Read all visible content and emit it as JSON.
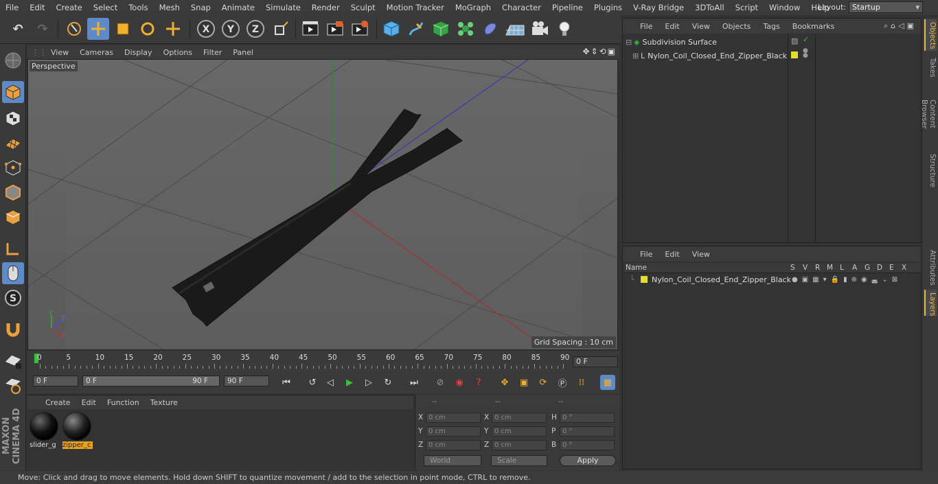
{
  "menubar": {
    "items": [
      "File",
      "Edit",
      "Create",
      "Select",
      "Tools",
      "Mesh",
      "Snap",
      "Animate",
      "Simulate",
      "Render",
      "Sculpt",
      "Motion Tracker",
      "MoGraph",
      "Character",
      "Pipeline",
      "Plugins",
      "V-Ray Bridge",
      "3DToAll",
      "Script",
      "Window",
      "Help"
    ],
    "layout_label": "Layout:",
    "layout_value": "Startup"
  },
  "viewport": {
    "menu": [
      "View",
      "Cameras",
      "Display",
      "Options",
      "Filter",
      "Panel"
    ],
    "camera_label": "Perspective",
    "grid_spacing": "Grid Spacing : 10 cm"
  },
  "timeline": {
    "ticks": [
      "0",
      "5",
      "10",
      "15",
      "20",
      "25",
      "30",
      "35",
      "40",
      "45",
      "50",
      "55",
      "60",
      "65",
      "70",
      "75",
      "80",
      "85",
      "90"
    ],
    "current_frame": "0 F"
  },
  "playback": {
    "start_field": "0 F",
    "range_start": "0 F",
    "range_end": "90 F",
    "end_field": "90 F"
  },
  "materials": {
    "menu": [
      "Create",
      "Edit",
      "Function",
      "Texture"
    ],
    "items": [
      {
        "name": "slider_g"
      },
      {
        "name": "zipper_c"
      }
    ]
  },
  "coordinates": {
    "headers": [
      "--",
      "--",
      "--"
    ],
    "rows": [
      {
        "l1": "X",
        "v1": "0 cm",
        "l2": "X",
        "v2": "0 cm",
        "l3": "H",
        "v3": "0 °"
      },
      {
        "l1": "Y",
        "v1": "0 cm",
        "l2": "Y",
        "v2": "0 cm",
        "l3": "P",
        "v3": "0 °"
      },
      {
        "l1": "Z",
        "v1": "0 cm",
        "l2": "Z",
        "v2": "0 cm",
        "l3": "B",
        "v3": "0 °"
      }
    ],
    "coord_mode": "World",
    "size_mode": "Scale",
    "apply_label": "Apply"
  },
  "objects": {
    "menu": [
      "File",
      "Edit",
      "View",
      "Objects",
      "Tags",
      "Bookmarks"
    ],
    "tree": [
      "Subdivision Surface",
      "Nylon_Coil_Closed_End_Zipper_Black"
    ]
  },
  "layers": {
    "menu": [
      "File",
      "Edit",
      "View"
    ],
    "columns": [
      "Name",
      "S",
      "V",
      "R",
      "M",
      "L",
      "A",
      "G",
      "D",
      "E",
      "X"
    ],
    "row": "Nylon_Coil_Closed_End_Zipper_Black"
  },
  "right_tabs": [
    "Objects",
    "Takes",
    "Content Browser",
    "Structure",
    "Attributes",
    "Layers"
  ],
  "status": "Move: Click and drag to move elements. Hold down SHIFT to quantize movement / add to the selection in point mode, CTRL to remove.",
  "brand": "MAXON CINEMA 4D",
  "colors": {
    "accent": "#5e8bc7",
    "layer_color": "#e5dd2a",
    "highlight": "#e8b84d"
  }
}
